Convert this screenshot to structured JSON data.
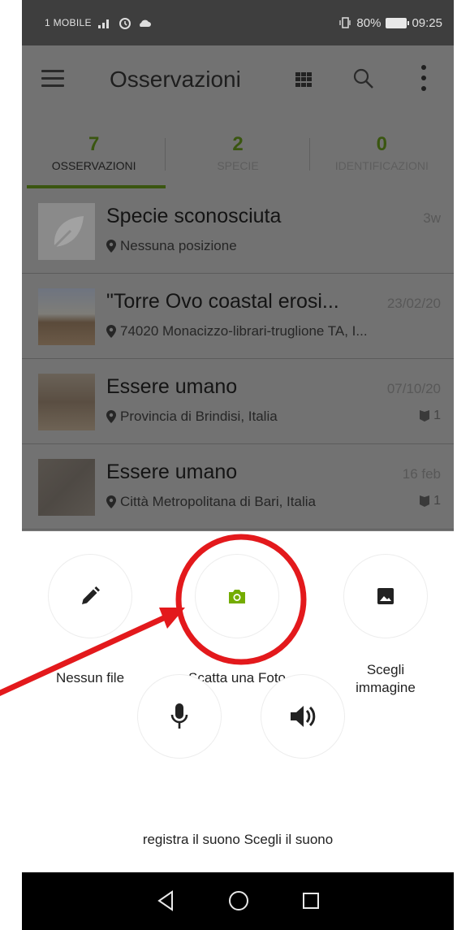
{
  "status_bar": {
    "carrier": "1 MOBILE",
    "battery": "80%",
    "time": "09:25"
  },
  "toolbar": {
    "title": "Osservazioni"
  },
  "tabs": [
    {
      "count": "7",
      "label": "OSSERVAZIONI"
    },
    {
      "count": "2",
      "label": "SPECIE"
    },
    {
      "count": "0",
      "label": "IDENTIFICAZIONI"
    }
  ],
  "observations": [
    {
      "title": "Specie sconosciuta",
      "date": "3w",
      "location": "Nessuna posizione",
      "ids": ""
    },
    {
      "title": "\"Torre Ovo coastal erosi...",
      "date": "23/02/20",
      "location": "74020 Monacizzo-librari-truglione TA, I...",
      "ids": ""
    },
    {
      "title": "Essere umano",
      "date": "07/10/20",
      "location": "Provincia di Brindisi, Italia",
      "ids": "1"
    },
    {
      "title": "Essere umano",
      "date": "16 feb",
      "location": "Città Metropolitana di Bari, Italia",
      "ids": "1"
    }
  ],
  "actions": {
    "no_file": "Nessun file",
    "take_photo": "Scatta una Foto",
    "choose_image_1": "Scegli",
    "choose_image_2": "immagine",
    "record_sound": "registra il suono",
    "choose_sound": "Scegli il suono"
  },
  "colors": {
    "accent": "#74ac00",
    "annotation": "#e3191c",
    "overlay": "#727272"
  },
  "icons": [
    "menu-icon",
    "grid-icon",
    "search-icon",
    "more-icon",
    "location-pin-icon",
    "pencil-icon",
    "camera-icon",
    "image-icon",
    "microphone-icon",
    "speaker-icon",
    "back-icon",
    "home-icon",
    "recents-icon"
  ]
}
